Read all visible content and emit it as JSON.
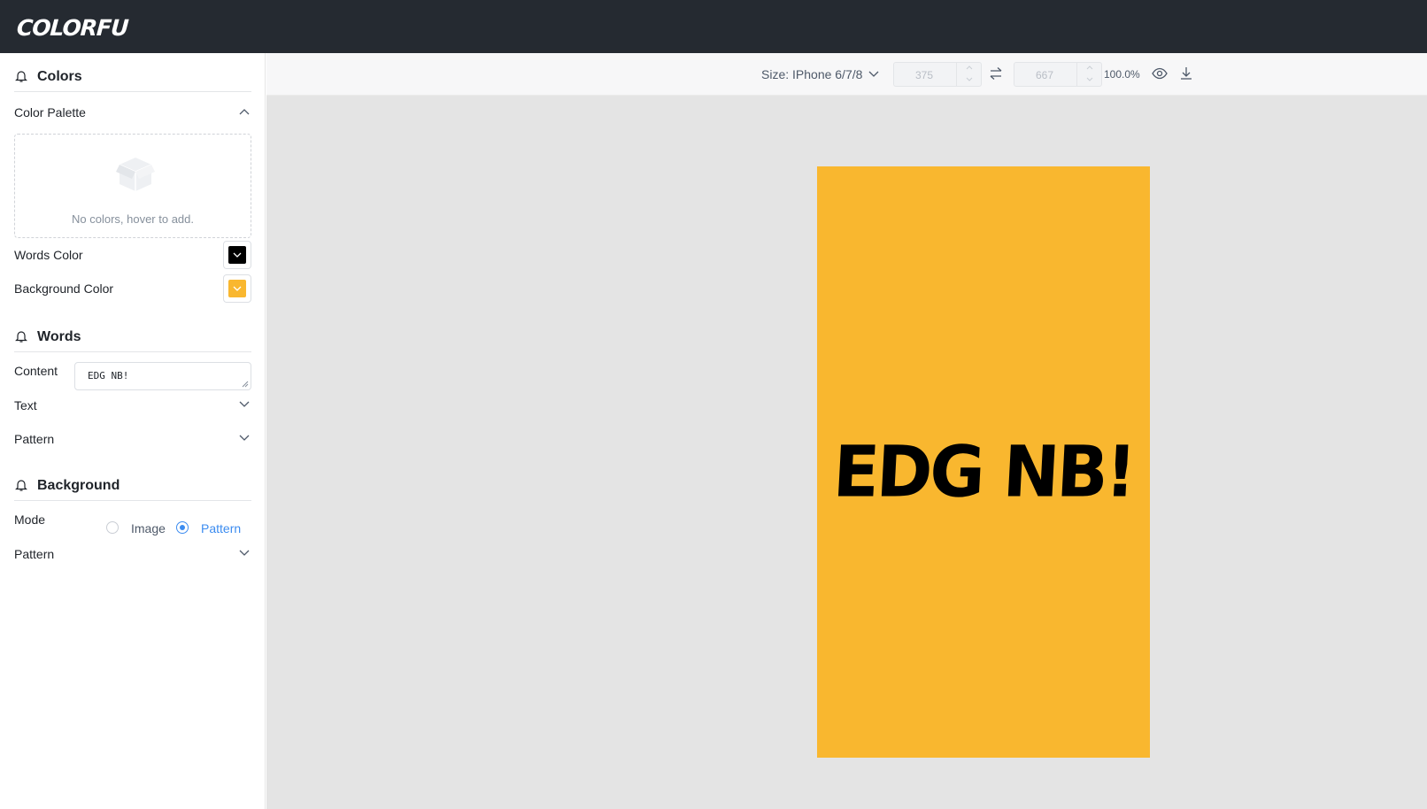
{
  "app": {
    "logo": "COLORFU"
  },
  "colors_section": {
    "title": "Colors",
    "palette_label": "Color Palette",
    "empty_text": "No colors, hover to add.",
    "words_color_label": "Words Color",
    "words_color": "#000000",
    "background_color_label": "Background Color",
    "background_color": "#f9b72f"
  },
  "words_section": {
    "title": "Words",
    "content_label": "Content",
    "content_value": "EDG NB!",
    "text_label": "Text",
    "pattern_label": "Pattern"
  },
  "background_section": {
    "title": "Background",
    "mode_label": "Mode",
    "mode_options": [
      "Image",
      "Pattern"
    ],
    "mode_selected": "Pattern",
    "pattern_label": "Pattern"
  },
  "toolbar": {
    "size_label": "Size: IPhone 6/7/8",
    "width_value": "375",
    "height_value": "667",
    "zoom": "100.0%"
  },
  "canvas": {
    "text": "EDG NB!",
    "background": "#f9b72f",
    "text_color": "#000000"
  }
}
